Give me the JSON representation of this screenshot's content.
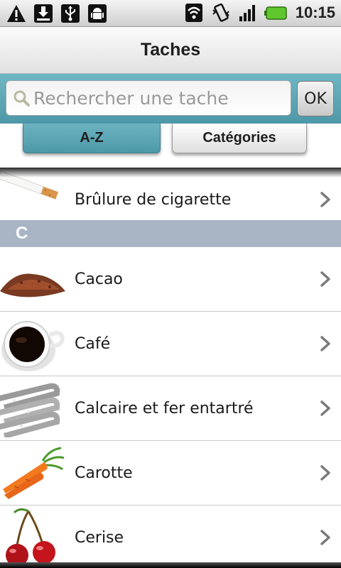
{
  "status_bar": {
    "left_icons": [
      "warning-icon",
      "download-icon",
      "usb-icon",
      "android-debug-icon"
    ],
    "right_icons": [
      "wifi-icon",
      "vibrate-icon",
      "signal-icon",
      "battery-icon"
    ],
    "time": "10:15"
  },
  "header": {
    "title": "Taches"
  },
  "search": {
    "placeholder": "Rechercher une tache",
    "value": "",
    "ok_label": "OK"
  },
  "tabs": [
    {
      "label": "A-Z",
      "selected": true
    },
    {
      "label": "Catégories",
      "selected": false
    }
  ],
  "list": {
    "rows": [
      {
        "label": "Brûlure de cigarette",
        "icon": "cigarette-icon"
      },
      {
        "section": "C"
      },
      {
        "label": "Cacao",
        "icon": "cocoa-powder-icon"
      },
      {
        "label": "Café",
        "icon": "coffee-cup-icon"
      },
      {
        "label": "Calcaire et fer entartré",
        "icon": "heating-element-icon"
      },
      {
        "label": "Carotte",
        "icon": "carrot-icon"
      },
      {
        "label": "Cerise",
        "icon": "cherry-icon"
      }
    ]
  },
  "colors": {
    "accent": "#5aa6b5",
    "section_header": "#a9b5c5",
    "title_bar": "#ececec"
  }
}
